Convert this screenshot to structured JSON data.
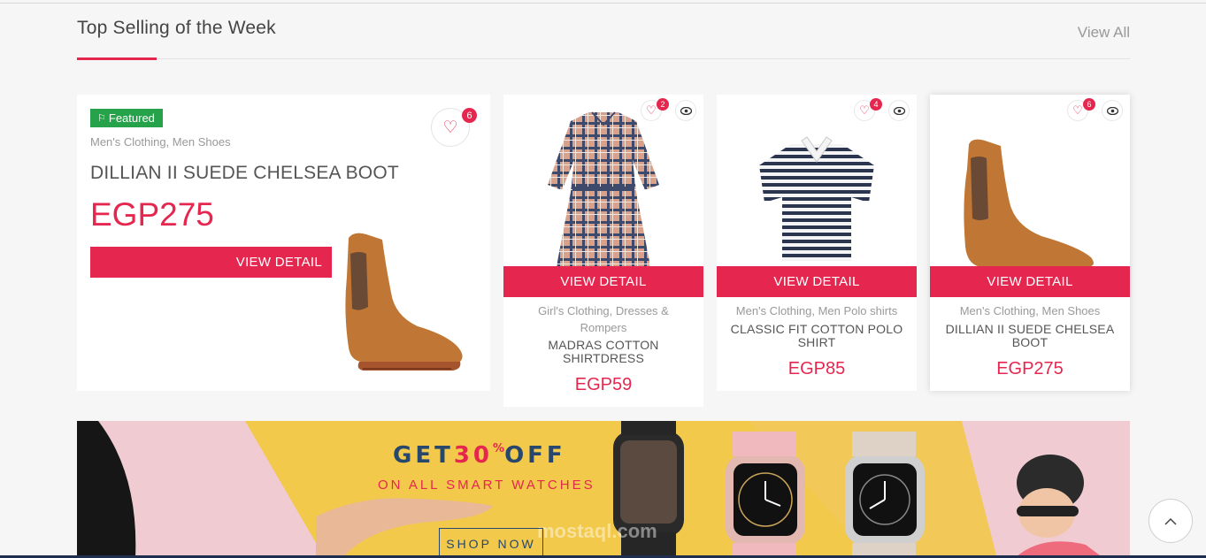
{
  "section": {
    "title": "Top Selling of the Week",
    "view_all": "View All"
  },
  "featured": {
    "badge": "Featured",
    "categories": "Men's Clothing, Men Shoes",
    "name": "DILLIAN II SUEDE CHELSEA BOOT",
    "price": "EGP275",
    "button": "VIEW DETAIL",
    "wishlist_count": "6"
  },
  "products": [
    {
      "categories": "Girl's Clothing, Dresses & Rompers",
      "name": "MADRAS COTTON SHIRTDRESS",
      "price": "EGP59",
      "button": "VIEW DETAIL",
      "wishlist_count": "2"
    },
    {
      "categories": "Men's Clothing, Men Polo shirts",
      "name": "CLASSIC FIT COTTON POLO SHIRT",
      "price": "EGP85",
      "button": "VIEW DETAIL",
      "wishlist_count": "4"
    },
    {
      "categories": "Men's Clothing, Men Shoes",
      "name": "DILLIAN II SUEDE CHELSEA BOOT",
      "price": "EGP275",
      "button": "VIEW DETAIL",
      "wishlist_count": "6"
    }
  ],
  "banner": {
    "headline_pre": "GET",
    "headline_num": "30",
    "headline_pct": "%",
    "headline_post": "OFF",
    "subline": "ON ALL SMART WATCHES",
    "button": "SHOP NOW",
    "watermark_text": "mostaql.com"
  },
  "icons": {
    "badge": "flag-icon",
    "wishlist": "heart-icon",
    "quick_view": "eye-icon",
    "scroll_top": "chevron-up-icon"
  },
  "colors": {
    "accent": "#e5274f",
    "badge": "#26a34a",
    "banner_navy": "#27476d",
    "banner_yellow": "#f2c94a",
    "banner_pink": "#f0cbd2"
  }
}
